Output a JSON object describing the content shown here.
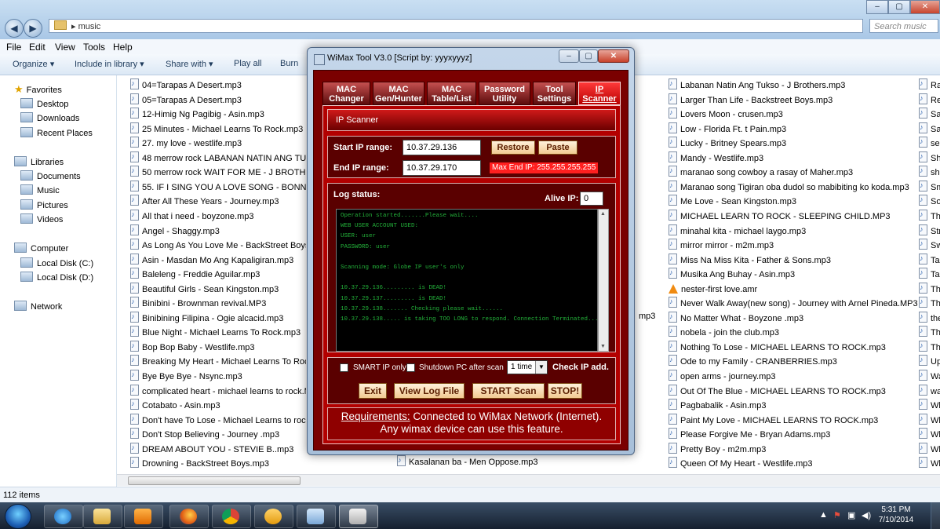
{
  "explorer": {
    "address": "music",
    "search_placeholder": "Search music",
    "menu": [
      "File",
      "Edit",
      "View",
      "Tools",
      "Help"
    ],
    "toolbar": [
      "Organize ▾",
      "Include in library ▾",
      "Share with ▾",
      "Play all",
      "Burn"
    ],
    "nav": {
      "favorites": "Favorites",
      "desktop": "Desktop",
      "downloads": "Downloads",
      "recent": "Recent Places",
      "libraries": "Libraries",
      "documents": "Documents",
      "music": "Music",
      "pictures": "Pictures",
      "videos": "Videos",
      "computer": "Computer",
      "disk_c": "Local Disk (C:)",
      "disk_d": "Local Disk (D:)",
      "network": "Network"
    },
    "col1": [
      "04=Tarapas A Desert.mp3",
      "05=Tarapas A Desert.mp3",
      "12-Himig Ng Pagibig - Asin.mp3",
      "25 Minutes - Michael Learns To Rock.mp3",
      "27.  my love - westlife.mp3",
      "48 merrow rock  LABANAN NATIN ANG TUKSO",
      "50 merrow rock  WAIT FOR ME - J BROTHERS.",
      "55.  IF I SING YOU A LOVE SONG - BONNIE TY",
      "After All These Years - Journey.mp3",
      "All that i need - boyzone.mp3",
      "Angel - Shaggy.mp3",
      "As Long As You Love Me - BackStreet Boys.mp",
      "Asin - Masdan Mo Ang Kapaligiran.mp3",
      "Baleleng - Freddie Aguilar.mp3",
      "Beautiful Girls - Sean Kingston.mp3",
      "Binibini - Brownman revival.MP3",
      "Binibining Filipina - Ogie alcacid.mp3",
      "Blue Night - Michael Learns To Rock.mp3",
      "Bop Bop Baby - Westlife.mp3",
      "Breaking My Heart - Michael Learns To Rock.m",
      "Bye Bye Bye - Nsync.mp3",
      "complicated heart - michael learns to rock.MP",
      "Cotabato - Asin.mp3",
      "Don't have To Lose - Michael Learns to rock.m",
      "Don't Stop Believing - Journey .mp3",
      "DREAM ABOUT YOU  - STEVIE B..mp3",
      "Drowning - BackStreet Boys.mp3"
    ],
    "col2_partial_1": "mp3",
    "col2_partial_2": "Kasalanan ba - Men Oppose.mp3",
    "col3": [
      "Labanan Natin Ang Tukso - J Brothers.mp3",
      "Larger Than Life - Backstreet Boys.mp3",
      "Lovers Moon - crusen.mp3",
      "Low - Florida Ft. t Pain.mp3",
      "Lucky - Britney Spears.mp3",
      "Mandy - Westlife.mp3",
      "maranao song cowboy a rasay of Maher.mp3",
      "Maranao song Tigiran oba dudol so mabibiting ko koda.mp3",
      "Me Love - Sean Kingston.mp3",
      "MICHAEL LEARN TO ROCK - SLEEPING CHILD.MP3",
      "minahal kita - michael laygo.mp3",
      "mirror mirror - m2m.mp3",
      "Miss Na Miss Kita - Father & Sons.mp3",
      "Musika Ang Buhay - Asin.mp3",
      "nester-first love.amr",
      "Never Walk Away(new song) - Journey with Arnel Pineda.MP3",
      "No Matter What - Boyzone .mp3",
      "nobela - join the club.mp3",
      "Nothing To Lose -  MICHAEL LEARNS TO ROCK.mp3",
      "Ode to my Family - CRANBERRIES.mp3",
      "open arms - journey.mp3",
      "Out Of The Blue  -  MICHAEL LEARNS TO ROCK.mp3",
      "Pagbabalik - Asin.mp3",
      "Paint My Love  -  MICHAEL LEARNS TO ROCK.mp3",
      "Please Forgive Me - Bryan Adams.mp3",
      "Pretty Boy - m2m.mp3",
      "Queen Of My Heart - Westlife.mp3"
    ],
    "col4": [
      "Ra",
      "Re",
      "Sa",
      "Sa",
      "sea",
      "Sh",
      "sho",
      "Sm",
      "So",
      "Th",
      "Str",
      "Sw",
      "Ta",
      "Ta",
      "Th",
      "Th",
      "the",
      "Th",
      "Th",
      "Up",
      "Wa",
      "wa",
      "Wh",
      "Wh",
      "Wh",
      "Wh",
      "Wh"
    ],
    "status": "112 items"
  },
  "wimax": {
    "title": "WiMax Tool V3.0 [Script by: yyyxyyyz]",
    "tabs": [
      {
        "l1": "MAC",
        "l2": "Changer"
      },
      {
        "l1": "MAC",
        "l2": "Gen/Hunter"
      },
      {
        "l1": "MAC",
        "l2": "Table/List"
      },
      {
        "l1": "Password",
        "l2": "Utility"
      },
      {
        "l1": "Tool",
        "l2": "Settings"
      },
      {
        "l1": "IP",
        "l2": "Scanner"
      }
    ],
    "section_title": "IP Scanner",
    "start_label": "Start IP range:",
    "start_value": "10.37.29.136",
    "end_label": "End IP range:",
    "end_value": "10.37.29.170",
    "restore": "Restore",
    "paste": "Paste",
    "max_end": "Max End IP: 255.255.255.255",
    "log_label": "Log status:",
    "alive_label": "Alive IP:",
    "alive_value": "0",
    "log_lines": [
      "Operation started.......Please wait....",
      "WEB USER ACCOUNT USED:",
      "USER: user",
      "PASSWORD: user",
      "",
      "Scanning mode: Globe IP user's only",
      "",
      "10.37.29.136......... is DEAD!",
      "10.37.29.137......... is DEAD!",
      "10.37.29.138....... Checking please wait......",
      "10.37.29.138..... is taking TOO LONG to respond. Connection Terminated...."
    ],
    "smart_ip": "SMART IP only",
    "shutdown": "Shutdown PC after scan",
    "times": "1 time",
    "check_ip": "Check IP add.",
    "exit": "Exit",
    "view_log": "View Log File",
    "start_scan": "START Scan",
    "stop": "STOP!",
    "req_heading": "Requirements:",
    "req_line1": " Connected to WiMax Network (Internet).",
    "req_line2": "Any wimax device can use this feature."
  },
  "taskbar": {
    "time": "5:31 PM",
    "date": "7/10/2014"
  }
}
